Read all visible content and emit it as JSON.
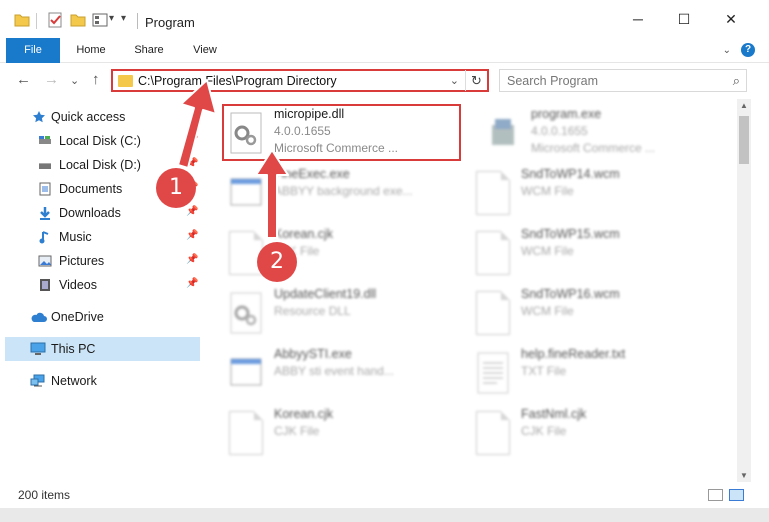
{
  "window": {
    "title": "Program",
    "minimize_icon": "─",
    "maximize_icon": "☐",
    "close_icon": "✕"
  },
  "ribbon": {
    "tabs": [
      "File",
      "Home",
      "Share",
      "View"
    ],
    "help_icon": "?",
    "collapse_icon": "⌄"
  },
  "address": {
    "back_icon": "←",
    "forward_icon": "→",
    "recent_icon": "⌄",
    "up_icon": "↑",
    "path": "C:\\Program Files\\Program Directory",
    "dropdown_icon": "⌄",
    "refresh_icon": "↻"
  },
  "search": {
    "placeholder": "Search Program",
    "icon": "⌕"
  },
  "nav": {
    "pin_icon": "📌",
    "items": [
      {
        "label": "Quick access",
        "icon": "star-icon"
      },
      {
        "label": "Local Disk (C:)",
        "icon": "drive-icon"
      },
      {
        "label": "Local Disk (D:)",
        "icon": "drive-icon"
      },
      {
        "label": "Documents",
        "icon": "document-icon"
      },
      {
        "label": "Downloads",
        "icon": "download-icon"
      },
      {
        "label": "Music",
        "icon": "music-icon"
      },
      {
        "label": "Pictures",
        "icon": "picture-icon"
      },
      {
        "label": "Videos",
        "icon": "video-icon"
      },
      {
        "label": "OneDrive",
        "icon": "cloud-icon"
      },
      {
        "label": "This PC",
        "icon": "computer-icon"
      },
      {
        "label": "Network",
        "icon": "network-icon"
      }
    ]
  },
  "files": [
    {
      "name": "micropipe.dll",
      "meta1": "4.0.0.1655",
      "meta2": "Microsoft Commerce ...",
      "icon": "gear-file-icon"
    },
    {
      "name": "program.exe",
      "meta1": "4.0.0.1655",
      "meta2": "Microsoft Commerce ...",
      "icon": "installer-icon"
    },
    {
      "name": "FineExec.exe",
      "meta1": "ABBYY background exe...",
      "meta2": "",
      "icon": "app-window-icon"
    },
    {
      "name": "SndToWP14.wcm",
      "meta1": "WCM File",
      "meta2": "",
      "icon": "blank-file-icon"
    },
    {
      "name": "Korean.cjk",
      "meta1": "CJK File",
      "meta2": "",
      "icon": "blank-file-icon"
    },
    {
      "name": "SndToWP15.wcm",
      "meta1": "WCM File",
      "meta2": "",
      "icon": "blank-file-icon"
    },
    {
      "name": "UpdateClient19.dll",
      "meta1": "Resource DLL",
      "meta2": "",
      "icon": "gear-file-icon"
    },
    {
      "name": "SndToWP16.wcm",
      "meta1": "WCM File",
      "meta2": "",
      "icon": "blank-file-icon"
    },
    {
      "name": "AbbyySTI.exe",
      "meta1": "ABBY sti event hand...",
      "meta2": "",
      "icon": "app-window-icon"
    },
    {
      "name": "help.fineReader.txt",
      "meta1": "TXT File",
      "meta2": "",
      "icon": "text-file-icon"
    },
    {
      "name": "Korean.cjk",
      "meta1": "CJK File",
      "meta2": "",
      "icon": "blank-file-icon"
    },
    {
      "name": "FastNml.cjk",
      "meta1": "CJK File",
      "meta2": "",
      "icon": "blank-file-icon"
    }
  ],
  "status": {
    "item_count": "200 items"
  },
  "callouts": [
    "1",
    "2"
  ],
  "colors": {
    "accent": "#1979ca",
    "highlight_red": "#d93a3a",
    "callout_red": "#e04848",
    "selection": "#cce4f7"
  }
}
